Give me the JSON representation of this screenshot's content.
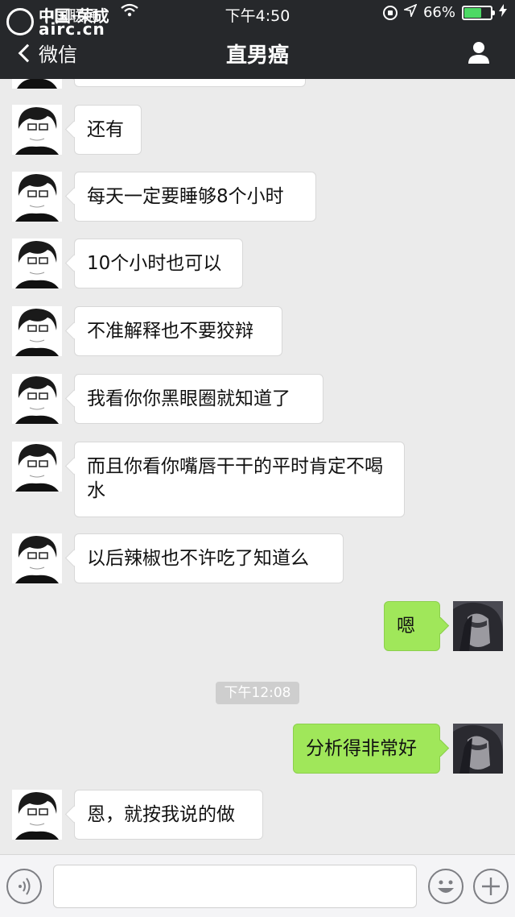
{
  "status_bar": {
    "carrier": "中国联通",
    "time": "下午4:50",
    "battery": "66%",
    "battery_level": 0.66
  },
  "watermark": {
    "line1": "中国·荣成",
    "line2": "airc.cn"
  },
  "nav": {
    "back_label": "微信",
    "title": "直男癌"
  },
  "messages": [
    {
      "side": "left",
      "text": "还有"
    },
    {
      "side": "left",
      "text": "每天一定要睡够8个小时"
    },
    {
      "side": "left",
      "text": "10个小时也可以"
    },
    {
      "side": "left",
      "text": "不准解释也不要狡辩"
    },
    {
      "side": "left",
      "text": "我看你你黑眼圈就知道了"
    },
    {
      "side": "left",
      "text": "而且你看你嘴唇干干的平时肯定不喝水"
    },
    {
      "side": "left",
      "text": "以后辣椒也不许吃了知道么"
    },
    {
      "side": "right",
      "text": "嗯"
    },
    {
      "side": "right",
      "text": "分析得非常好"
    },
    {
      "side": "left",
      "text": "恩，就按我说的做"
    }
  ],
  "timestamp": "下午12:08",
  "colors": {
    "nav_bg": "#26282b",
    "chat_bg": "#ebebeb",
    "self_bubble": "#a0e75a",
    "other_bubble": "#ffffff"
  },
  "icons": {
    "back": "chevron-left-icon",
    "profile": "person-icon",
    "voice": "voice-icon",
    "emoji": "smiley-icon",
    "more": "plus-icon"
  }
}
